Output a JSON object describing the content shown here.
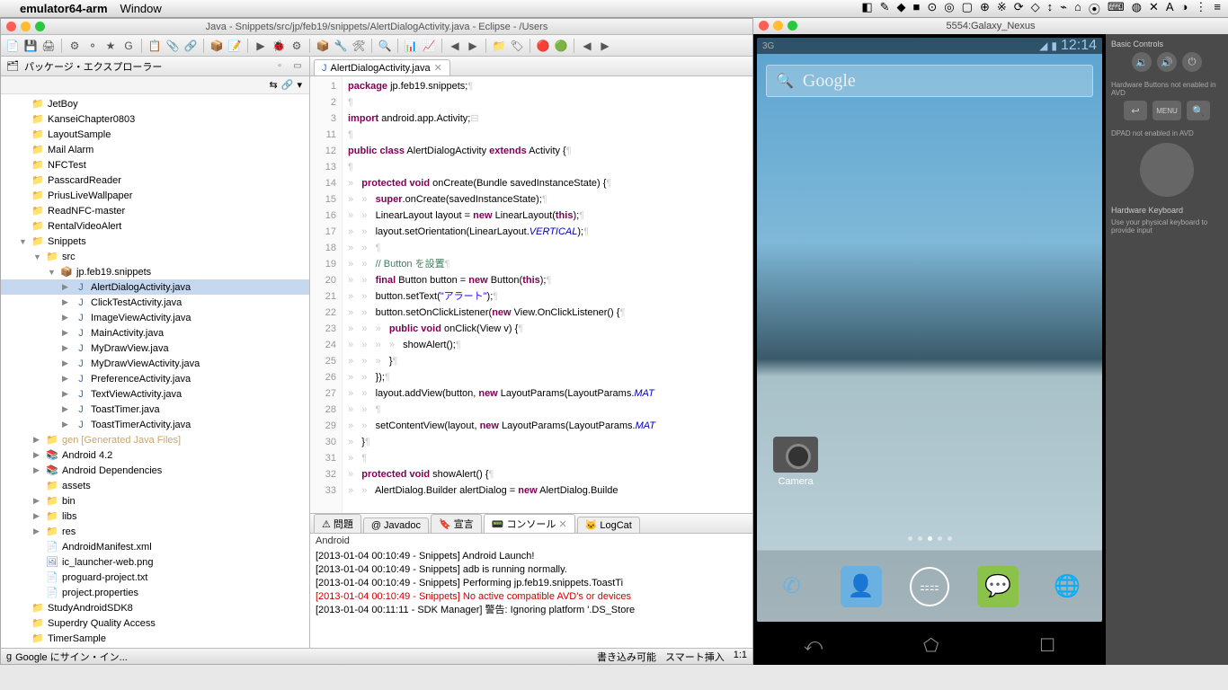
{
  "mac_menu": {
    "app": "emulator64-arm",
    "items": [
      "Window"
    ],
    "right_icons": [
      "◧",
      "✎",
      "◆",
      "■",
      "⊙",
      "◎",
      "▢",
      "⊕",
      "※",
      "⟳",
      "◇",
      "↕",
      "⌁",
      "⌂",
      "⦿",
      "⌨",
      "◍",
      "✕",
      "A",
      "◑",
      "⋮",
      "≡"
    ]
  },
  "eclipse": {
    "title": "Java - Snippets/src/jp/feb19/snippets/AlertDialogActivity.java - Eclipse - /Users",
    "toolbar_icons": [
      "📄",
      "💾",
      "🖨",
      "|",
      "⚙",
      "⚬",
      "★",
      "G",
      "|",
      "📋",
      "📎",
      "🔗",
      "|",
      "📦",
      "📝",
      "|",
      "▶",
      "🐞",
      "⚙",
      "|",
      "📦",
      "🔧",
      "🛠",
      "|",
      "🔍",
      "|",
      "📊",
      "📈",
      "|",
      "◀",
      "▶",
      "|",
      "📁",
      "🏷",
      "|",
      "🔴",
      "🟢",
      "|",
      "◀",
      "▶"
    ],
    "explorer": {
      "title": "パッケージ・エクスプローラー",
      "items": [
        {
          "label": "JetBoy",
          "icon": "📁",
          "pad": 1
        },
        {
          "label": "KanseiChapter0803",
          "icon": "📁",
          "pad": 1
        },
        {
          "label": "LayoutSample",
          "icon": "📁",
          "pad": 1
        },
        {
          "label": "Mail Alarm",
          "icon": "📁",
          "pad": 1
        },
        {
          "label": "NFCTest",
          "icon": "📁",
          "pad": 1
        },
        {
          "label": "PasscardReader",
          "icon": "📁",
          "pad": 1
        },
        {
          "label": "PriusLiveWallpaper",
          "icon": "📁",
          "pad": 1
        },
        {
          "label": "ReadNFC-master",
          "icon": "📁",
          "pad": 1
        },
        {
          "label": "RentalVideoAlert",
          "icon": "📁",
          "pad": 1
        },
        {
          "label": "Snippets",
          "icon": "📁",
          "pad": 1,
          "arrow": "▼"
        },
        {
          "label": "src",
          "icon": "📁",
          "pad": 2,
          "arrow": "▼"
        },
        {
          "label": "jp.feb19.snippets",
          "icon": "📦",
          "pad": 3,
          "arrow": "▼"
        },
        {
          "label": "AlertDialogActivity.java",
          "icon": "J",
          "pad": 4,
          "arrow": "▶",
          "selected": true
        },
        {
          "label": "ClickTestActivity.java",
          "icon": "J",
          "pad": 4,
          "arrow": "▶"
        },
        {
          "label": "ImageViewActivity.java",
          "icon": "J",
          "pad": 4,
          "arrow": "▶"
        },
        {
          "label": "MainActivity.java",
          "icon": "J",
          "pad": 4,
          "arrow": "▶"
        },
        {
          "label": "MyDrawView.java",
          "icon": "J",
          "pad": 4,
          "arrow": "▶"
        },
        {
          "label": "MyDrawViewActivity.java",
          "icon": "J",
          "pad": 4,
          "arrow": "▶"
        },
        {
          "label": "PreferenceActivity.java",
          "icon": "J",
          "pad": 4,
          "arrow": "▶"
        },
        {
          "label": "TextViewActivity.java",
          "icon": "J",
          "pad": 4,
          "arrow": "▶"
        },
        {
          "label": "ToastTimer.java",
          "icon": "J",
          "pad": 4,
          "arrow": "▶"
        },
        {
          "label": "ToastTimerActivity.java",
          "icon": "J",
          "pad": 4,
          "arrow": "▶"
        },
        {
          "label": "gen [Generated Java Files]",
          "icon": "📁",
          "pad": 2,
          "arrow": "▶",
          "dim": true
        },
        {
          "label": "Android 4.2",
          "icon": "📚",
          "pad": 2,
          "arrow": "▶"
        },
        {
          "label": "Android Dependencies",
          "icon": "📚",
          "pad": 2,
          "arrow": "▶"
        },
        {
          "label": "assets",
          "icon": "📁",
          "pad": 2
        },
        {
          "label": "bin",
          "icon": "📁",
          "pad": 2,
          "arrow": "▶"
        },
        {
          "label": "libs",
          "icon": "📁",
          "pad": 2,
          "arrow": "▶"
        },
        {
          "label": "res",
          "icon": "📁",
          "pad": 2,
          "arrow": "▶"
        },
        {
          "label": "AndroidManifest.xml",
          "icon": "📄",
          "pad": 2
        },
        {
          "label": "ic_launcher-web.png",
          "icon": "🖼",
          "pad": 2
        },
        {
          "label": "proguard-project.txt",
          "icon": "📄",
          "pad": 2
        },
        {
          "label": "project.properties",
          "icon": "📄",
          "pad": 2
        },
        {
          "label": "StudyAndroidSDK8",
          "icon": "📁",
          "pad": 1
        },
        {
          "label": "Superdry Quality Access",
          "icon": "📁",
          "pad": 1
        },
        {
          "label": "TimerSample",
          "icon": "📁",
          "pad": 1
        }
      ]
    },
    "editor": {
      "tab": "AlertDialogActivity.java",
      "lines": [
        {
          "n": 1,
          "html": "<span class='kw'>package</span> jp.feb19.snippets;<span class='ws'>¶</span>"
        },
        {
          "n": 2,
          "html": "<span class='ws'>¶</span>"
        },
        {
          "n": 3,
          "html": "<span class='kw'>import</span> android.app.Activity;<span class='ws'>⊟</span>"
        },
        {
          "n": 11,
          "html": "<span class='ws'>¶</span>"
        },
        {
          "n": 12,
          "html": "<span class='kw'>public class</span> AlertDialogActivity <span class='kw'>extends</span> Activity {<span class='ws'>¶</span>"
        },
        {
          "n": 13,
          "html": "<span class='ws'>¶</span>"
        },
        {
          "n": 14,
          "html": "<span class='ws'>»   </span><span class='kw'>protected void</span> onCreate(Bundle savedInstanceState) {<span class='ws'>¶</span>"
        },
        {
          "n": 15,
          "html": "<span class='ws'>»   »   </span><span class='kw'>super</span>.onCreate(savedInstanceState);<span class='ws'>¶</span>"
        },
        {
          "n": 16,
          "html": "<span class='ws'>»   »   </span>LinearLayout layout = <span class='kw'>new</span> LinearLayout(<span class='kw'>this</span>);<span class='ws'>¶</span>"
        },
        {
          "n": 17,
          "html": "<span class='ws'>»   »   </span>layout.setOrientation(LinearLayout.<span class='const'>VERTICAL</span>);<span class='ws'>¶</span>"
        },
        {
          "n": 18,
          "html": "<span class='ws'>»   »   ¶</span>"
        },
        {
          "n": 19,
          "html": "<span class='ws'>»   »   </span><span class='com'>// Button を設置</span><span class='ws'>¶</span>"
        },
        {
          "n": 20,
          "html": "<span class='ws'>»   »   </span><span class='kw'>final</span> Button button = <span class='kw'>new</span> Button(<span class='kw'>this</span>);<span class='ws'>¶</span>"
        },
        {
          "n": 21,
          "html": "<span class='ws'>»   »   </span>button.setText(<span class='str'>\"アラート\"</span>);<span class='ws'>¶</span>"
        },
        {
          "n": 22,
          "html": "<span class='ws'>»   »   </span>button.setOnClickListener(<span class='kw'>new</span> View.OnClickListener() {<span class='ws'>¶</span>"
        },
        {
          "n": 23,
          "html": "<span class='ws'>»   »   »   </span><span class='kw'>public void</span> onClick(View v) {<span class='ws'>¶</span>"
        },
        {
          "n": 24,
          "html": "<span class='ws'>»   »   »   »   </span>showAlert();<span class='ws'>¶</span>"
        },
        {
          "n": 25,
          "html": "<span class='ws'>»   »   »   </span>}<span class='ws'>¶</span>"
        },
        {
          "n": 26,
          "html": "<span class='ws'>»   »   </span>});<span class='ws'>¶</span>"
        },
        {
          "n": 27,
          "html": "<span class='ws'>»   »   </span>layout.addView(button, <span class='kw'>new</span> LayoutParams(LayoutParams.<span class='const'>MAT</span>"
        },
        {
          "n": 28,
          "html": "<span class='ws'>»   »   ¶</span>"
        },
        {
          "n": 29,
          "html": "<span class='ws'>»   »   </span>setContentView(layout, <span class='kw'>new</span> LayoutParams(LayoutParams.<span class='const'>MAT</span>"
        },
        {
          "n": 30,
          "html": "<span class='ws'>»   </span>}<span class='ws'>¶</span>"
        },
        {
          "n": 31,
          "html": "<span class='ws'>»   ¶</span>"
        },
        {
          "n": 32,
          "html": "<span class='ws'>»   </span><span class='kw'>protected void</span> showAlert() {<span class='ws'>¶</span>"
        },
        {
          "n": 33,
          "html": "<span class='ws'>»   »   </span>AlertDialog.Builder alertDialog = <span class='kw'>new</span> AlertDialog.Builde"
        }
      ]
    },
    "console": {
      "tabs": [
        "問題",
        "Javadoc",
        "宣言",
        "コンソール",
        "LogCat"
      ],
      "active": 3,
      "header": "Android",
      "lines": [
        {
          "t": "[2013-01-04 00:10:49 - Snippets] Android Launch!"
        },
        {
          "t": "[2013-01-04 00:10:49 - Snippets] adb is running normally."
        },
        {
          "t": "[2013-01-04 00:10:49 - Snippets] Performing jp.feb19.snippets.ToastTi"
        },
        {
          "t": "[2013-01-04 00:10:49 - Snippets] No active compatible AVD's or devices",
          "err": true
        },
        {
          "t": "[2013-01-04 00:11:11 - SDK Manager] 警告: Ignoring platform '.DS_Store"
        }
      ]
    },
    "status": {
      "left": "Google にサイン・イン...",
      "right": [
        "書き込み可能",
        "スマート挿入",
        "1:1"
      ]
    }
  },
  "emulator": {
    "title": "5554:Galaxy_Nexus",
    "android_status": {
      "net": "3G",
      "time": "12:14"
    },
    "search": "Google",
    "camera_label": "Camera",
    "controls": {
      "basic": "Basic Controls",
      "hw_note": "Hardware Buttons not enabled in AVD",
      "dpad_note": "DPAD not enabled in AVD",
      "keyboard": "Hardware Keyboard",
      "keyboard_note": "Use your physical keyboard to provide input"
    }
  }
}
